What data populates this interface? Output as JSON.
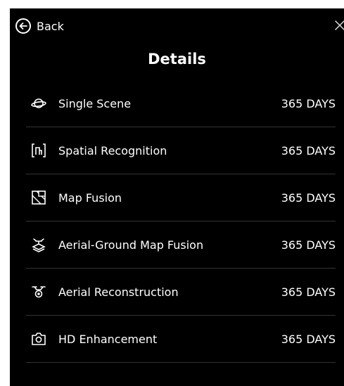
{
  "header": {
    "back_label": "Back",
    "title": "Details"
  },
  "items": [
    {
      "label": "Single Scene",
      "value": "365 DAYS",
      "icon": "planet-icon"
    },
    {
      "label": "Spatial Recognition",
      "value": "365 DAYS",
      "icon": "spatial-recognition-icon"
    },
    {
      "label": "Map Fusion",
      "value": "365 DAYS",
      "icon": "map-fusion-icon"
    },
    {
      "label": "Aerial-Ground Map Fusion",
      "value": "365 DAYS",
      "icon": "aerial-ground-icon"
    },
    {
      "label": "Aerial Reconstruction",
      "value": "365 DAYS",
      "icon": "drone-icon"
    },
    {
      "label": "HD Enhancement",
      "value": "365 DAYS",
      "icon": "camera-icon"
    }
  ],
  "colors": {
    "background": "#000000",
    "text": "#ffffff",
    "divider": "#333333"
  }
}
